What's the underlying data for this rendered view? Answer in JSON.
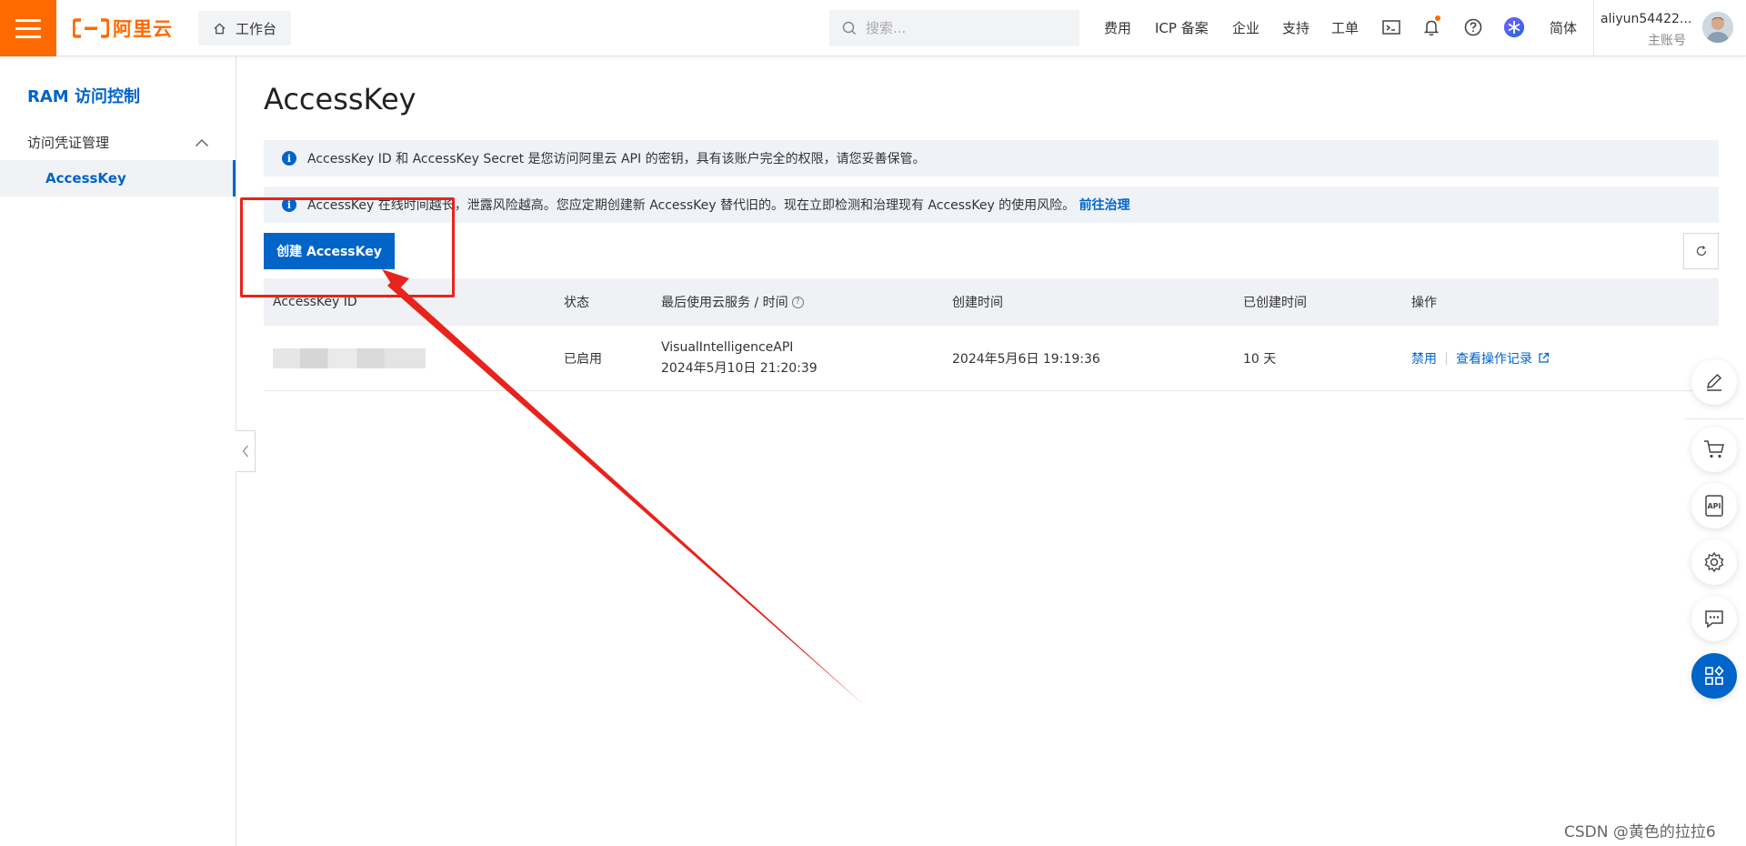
{
  "header": {
    "logo_text": "阿里云",
    "workbench_label": "工作台",
    "search_placeholder": "搜索...",
    "nav": [
      "费用",
      "ICP 备案",
      "企业",
      "支持",
      "工单"
    ],
    "lang_label": "简体",
    "user_name": "aliyun54422...",
    "user_role": "主账号",
    "brand_color": "#ff6a00",
    "icons": [
      "menu-icon",
      "home-icon",
      "search-icon",
      "terminal-icon",
      "bell-icon",
      "help-icon",
      "accessibility-icon"
    ]
  },
  "sidebar": {
    "title": "RAM 访问控制",
    "group_label": "访问凭证管理",
    "active_item": "AccessKey"
  },
  "main": {
    "title": "AccessKey",
    "notice_1": "AccessKey ID 和 AccessKey Secret 是您访问阿里云 API 的密钥，具有该账户完全的权限，请您妥善保管。",
    "notice_2_text": "AccessKey 在线时间越长，泄露风险越高。您应定期创建新 AccessKey 替代旧的。现在立即检测和治理现有 AccessKey 的使用风险。",
    "notice_2_link": "前往治理",
    "create_button": "创建 AccessKey",
    "accent_color": "#0064c8"
  },
  "table": {
    "headers": {
      "id": "AccessKey ID",
      "status": "状态",
      "last_used": "最后使用云服务 / 时间",
      "created": "创建时间",
      "age": "已创建时间",
      "ops": "操作"
    },
    "rows": [
      {
        "status": "已启用",
        "last_service": "VisualIntelligenceAPI",
        "last_time": "2024年5月10日 21:20:39",
        "created": "2024年5月6日 19:19:36",
        "age": "10 天",
        "op_disable": "禁用",
        "op_log": "查看操作记录"
      }
    ]
  },
  "floating_toolbar": [
    "edit-icon",
    "cart-icon",
    "api-icon",
    "settings-icon",
    "chat-icon",
    "apps-icon"
  ],
  "watermark": "CSDN @黄色的拉拉6"
}
